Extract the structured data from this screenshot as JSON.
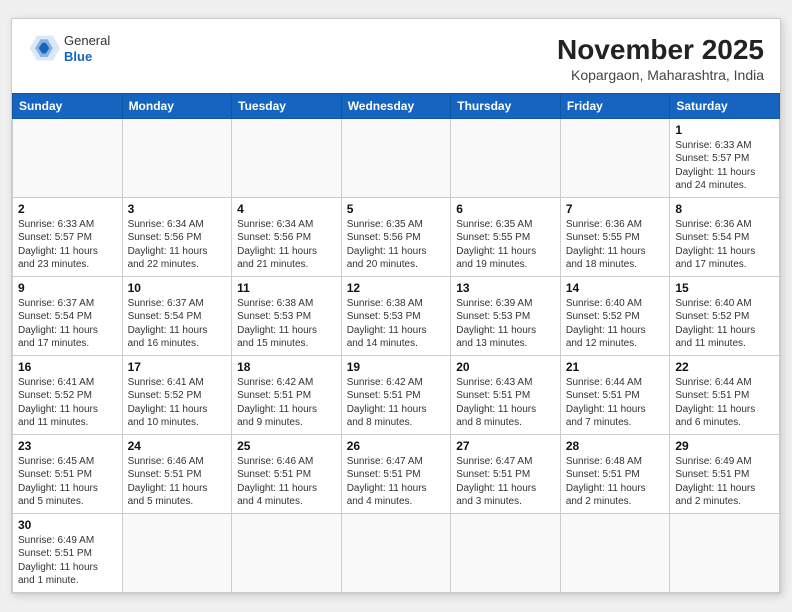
{
  "header": {
    "logo_general": "General",
    "logo_blue": "Blue",
    "month_title": "November 2025",
    "location": "Kopargaon, Maharashtra, India"
  },
  "weekdays": [
    "Sunday",
    "Monday",
    "Tuesday",
    "Wednesday",
    "Thursday",
    "Friday",
    "Saturday"
  ],
  "weeks": [
    [
      {
        "day": "",
        "info": ""
      },
      {
        "day": "",
        "info": ""
      },
      {
        "day": "",
        "info": ""
      },
      {
        "day": "",
        "info": ""
      },
      {
        "day": "",
        "info": ""
      },
      {
        "day": "",
        "info": ""
      },
      {
        "day": "1",
        "info": "Sunrise: 6:33 AM\nSunset: 5:57 PM\nDaylight: 11 hours\nand 24 minutes."
      }
    ],
    [
      {
        "day": "2",
        "info": "Sunrise: 6:33 AM\nSunset: 5:57 PM\nDaylight: 11 hours\nand 23 minutes."
      },
      {
        "day": "3",
        "info": "Sunrise: 6:34 AM\nSunset: 5:56 PM\nDaylight: 11 hours\nand 22 minutes."
      },
      {
        "day": "4",
        "info": "Sunrise: 6:34 AM\nSunset: 5:56 PM\nDaylight: 11 hours\nand 21 minutes."
      },
      {
        "day": "5",
        "info": "Sunrise: 6:35 AM\nSunset: 5:56 PM\nDaylight: 11 hours\nand 20 minutes."
      },
      {
        "day": "6",
        "info": "Sunrise: 6:35 AM\nSunset: 5:55 PM\nDaylight: 11 hours\nand 19 minutes."
      },
      {
        "day": "7",
        "info": "Sunrise: 6:36 AM\nSunset: 5:55 PM\nDaylight: 11 hours\nand 18 minutes."
      },
      {
        "day": "8",
        "info": "Sunrise: 6:36 AM\nSunset: 5:54 PM\nDaylight: 11 hours\nand 17 minutes."
      }
    ],
    [
      {
        "day": "9",
        "info": "Sunrise: 6:37 AM\nSunset: 5:54 PM\nDaylight: 11 hours\nand 17 minutes."
      },
      {
        "day": "10",
        "info": "Sunrise: 6:37 AM\nSunset: 5:54 PM\nDaylight: 11 hours\nand 16 minutes."
      },
      {
        "day": "11",
        "info": "Sunrise: 6:38 AM\nSunset: 5:53 PM\nDaylight: 11 hours\nand 15 minutes."
      },
      {
        "day": "12",
        "info": "Sunrise: 6:38 AM\nSunset: 5:53 PM\nDaylight: 11 hours\nand 14 minutes."
      },
      {
        "day": "13",
        "info": "Sunrise: 6:39 AM\nSunset: 5:53 PM\nDaylight: 11 hours\nand 13 minutes."
      },
      {
        "day": "14",
        "info": "Sunrise: 6:40 AM\nSunset: 5:52 PM\nDaylight: 11 hours\nand 12 minutes."
      },
      {
        "day": "15",
        "info": "Sunrise: 6:40 AM\nSunset: 5:52 PM\nDaylight: 11 hours\nand 11 minutes."
      }
    ],
    [
      {
        "day": "16",
        "info": "Sunrise: 6:41 AM\nSunset: 5:52 PM\nDaylight: 11 hours\nand 11 minutes."
      },
      {
        "day": "17",
        "info": "Sunrise: 6:41 AM\nSunset: 5:52 PM\nDaylight: 11 hours\nand 10 minutes."
      },
      {
        "day": "18",
        "info": "Sunrise: 6:42 AM\nSunset: 5:51 PM\nDaylight: 11 hours\nand 9 minutes."
      },
      {
        "day": "19",
        "info": "Sunrise: 6:42 AM\nSunset: 5:51 PM\nDaylight: 11 hours\nand 8 minutes."
      },
      {
        "day": "20",
        "info": "Sunrise: 6:43 AM\nSunset: 5:51 PM\nDaylight: 11 hours\nand 8 minutes."
      },
      {
        "day": "21",
        "info": "Sunrise: 6:44 AM\nSunset: 5:51 PM\nDaylight: 11 hours\nand 7 minutes."
      },
      {
        "day": "22",
        "info": "Sunrise: 6:44 AM\nSunset: 5:51 PM\nDaylight: 11 hours\nand 6 minutes."
      }
    ],
    [
      {
        "day": "23",
        "info": "Sunrise: 6:45 AM\nSunset: 5:51 PM\nDaylight: 11 hours\nand 5 minutes."
      },
      {
        "day": "24",
        "info": "Sunrise: 6:46 AM\nSunset: 5:51 PM\nDaylight: 11 hours\nand 5 minutes."
      },
      {
        "day": "25",
        "info": "Sunrise: 6:46 AM\nSunset: 5:51 PM\nDaylight: 11 hours\nand 4 minutes."
      },
      {
        "day": "26",
        "info": "Sunrise: 6:47 AM\nSunset: 5:51 PM\nDaylight: 11 hours\nand 4 minutes."
      },
      {
        "day": "27",
        "info": "Sunrise: 6:47 AM\nSunset: 5:51 PM\nDaylight: 11 hours\nand 3 minutes."
      },
      {
        "day": "28",
        "info": "Sunrise: 6:48 AM\nSunset: 5:51 PM\nDaylight: 11 hours\nand 2 minutes."
      },
      {
        "day": "29",
        "info": "Sunrise: 6:49 AM\nSunset: 5:51 PM\nDaylight: 11 hours\nand 2 minutes."
      }
    ],
    [
      {
        "day": "30",
        "info": "Sunrise: 6:49 AM\nSunset: 5:51 PM\nDaylight: 11 hours\nand 1 minute."
      },
      {
        "day": "",
        "info": ""
      },
      {
        "day": "",
        "info": ""
      },
      {
        "day": "",
        "info": ""
      },
      {
        "day": "",
        "info": ""
      },
      {
        "day": "",
        "info": ""
      },
      {
        "day": "",
        "info": ""
      }
    ]
  ]
}
